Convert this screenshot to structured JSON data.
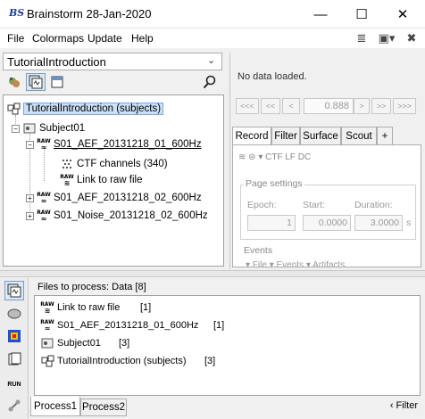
{
  "window": {
    "title": "Brainstorm 28-Jan-2020",
    "logo": "BS",
    "min_glyph": "—",
    "max_glyph": "☐",
    "close_glyph": "✕"
  },
  "menu": {
    "file": "File",
    "colormaps": "Colormaps",
    "update": "Update",
    "help": "Help"
  },
  "toolbar_icons": {
    "layout": "≣",
    "window_layout": "▣▾",
    "close_all": "✖"
  },
  "protocol": {
    "selected": "TutorialIntroduction",
    "chevron": "⌄"
  },
  "tree": {
    "root": "TutorialIntroduction (subjects)",
    "subject": "Subject01",
    "raw1": "S01_AEF_20131218_01_600Hz",
    "ctf_channels": "CTF channels (340)",
    "link_raw": "Link to raw file",
    "raw2": "S01_AEF_20131218_02_600Hz",
    "noise": "S01_Noise_20131218_02_600Hz",
    "raw_label": "RAW",
    "expand_minus": "−",
    "expand_plus": "+"
  },
  "right_panel": {
    "no_data": "No data loaded.",
    "nav": [
      "<<<",
      "<<",
      "<",
      ">",
      ">>",
      ">>>"
    ],
    "time_value": "0.888",
    "tabs": [
      "Record",
      "Filter",
      "Surface",
      "Scout",
      "+"
    ],
    "filter_row": "≋  ⊜  ▾ CTF LF   DC",
    "page_settings": "Page settings",
    "epoch_label": "Epoch:",
    "start_label": "Start:",
    "duration_label": "Duration:",
    "epoch_value": "1",
    "start_value": "0.0000",
    "duration_value": "3.0000",
    "duration_unit": "s",
    "events_title": "Events",
    "events_sub": "▾ File   ▾ Events   ▾ Artifacts"
  },
  "process": {
    "files_title": "Files to process: Data [8]",
    "files": [
      {
        "label": "Link to raw file",
        "count": "[1]"
      },
      {
        "label": "S01_AEF_20131218_01_600Hz",
        "count": "[1]"
      },
      {
        "label": "Subject01",
        "count": "[3]"
      },
      {
        "label": "TutorialIntroduction (subjects)",
        "count": "[3]"
      }
    ],
    "tabs": [
      "Process1",
      "Process2"
    ],
    "filter": "‹ Filter",
    "run_label": "RUN"
  }
}
